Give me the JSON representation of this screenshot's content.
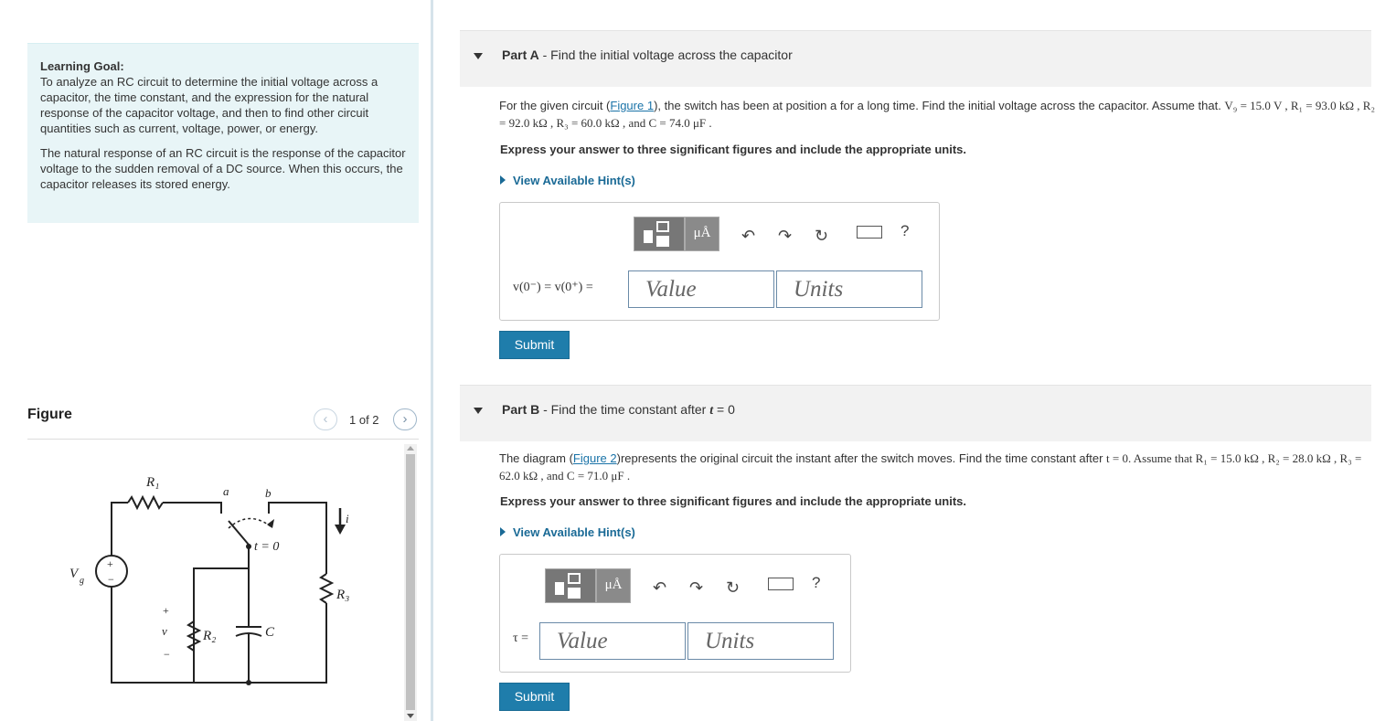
{
  "learning_goal": {
    "title": "Learning Goal:",
    "text1": "To analyze an RC circuit to determine the initial voltage across a capacitor, the time constant, and the expression for the natural response of the capacitor voltage, and then to find other circuit quantities such as current, voltage, power, or energy.",
    "text2": "The natural response of an RC circuit is the response of the capacitor voltage to the sudden removal of a DC source. When this occurs, the capacitor releases its stored energy."
  },
  "figure": {
    "title": "Figure",
    "counter": "1 of 2",
    "prev_icon": "chevron-left-icon",
    "next_icon": "chevron-right-icon",
    "labels": {
      "r1": "R₁",
      "r2": "R₂",
      "r3": "R₃",
      "c": "C",
      "vg": "V",
      "vg_sub": "g",
      "v": "v",
      "a": "a",
      "b": "b",
      "t0": "t = 0",
      "i": "i",
      "plus": "+",
      "minus": "−"
    }
  },
  "part_a": {
    "label": "Part A",
    "title": " - Find the initial voltage across the capacitor",
    "q_pre": "For the given circuit (",
    "q_link": "Figure 1",
    "q_post": "), the switch has been at position a for a long time. Find the initial voltage across the capacitor. Assume that. ",
    "q_vals": "V₉ = 15.0 V , R₁ = 93.0 kΩ , R₂ = 92.0 kΩ , R₃ = 60.0 kΩ , and C = 74.0 μF .",
    "instruction": "Express your answer to three significant figures and include the appropriate units.",
    "hint": "View Available Hint(s)",
    "answer_label": "v(0⁻) = v(0⁺) =",
    "value_placeholder": "Value",
    "units_placeholder": "Units",
    "submit": "Submit"
  },
  "part_b": {
    "label": "Part B",
    "title": " - Find the time constant after ",
    "title_t": "t",
    "title_end": " = 0",
    "q_pre": "The diagram (",
    "q_link": "Figure 2",
    "q_post": ")represents the original circuit the instant after the switch moves. Find the time constant after ",
    "q_vals": "t = 0. Assume that R₁ = 15.0 kΩ , R₂ = 28.0 kΩ , R₃ = 62.0 kΩ , and C = 71.0 μF .",
    "instruction": "Express your answer to three significant figures and include the appropriate units.",
    "hint": "View Available Hint(s)",
    "answer_label": "τ =",
    "value_placeholder": "Value",
    "units_placeholder": "Units",
    "submit": "Submit"
  },
  "toolbar": {
    "units_btn": "μÅ",
    "undo_icon": "undo-icon",
    "redo_icon": "redo-icon",
    "reset_icon": "reset-icon",
    "keyboard_icon": "keyboard-icon",
    "help": "?"
  },
  "colors": {
    "accent": "#1f7dab",
    "goal_bg": "#e8f5f7",
    "link": "#1a73a8"
  }
}
